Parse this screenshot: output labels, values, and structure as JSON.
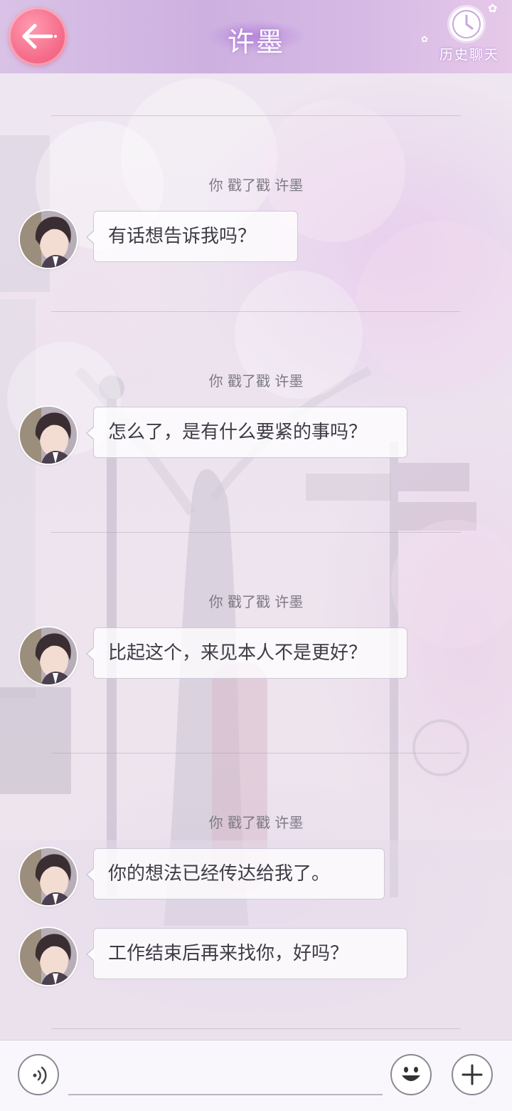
{
  "header": {
    "title": "许墨",
    "history_label": "历史聊天"
  },
  "chat": {
    "messages": [
      {
        "system": "你 戳了戳 许墨",
        "text": "有话想告诉我吗？"
      },
      {
        "system": "你 戳了戳 许墨",
        "text": "怎么了，是有什么要紧的事吗？"
      },
      {
        "system": "你 戳了戳 许墨",
        "text": "比起这个，来见本人不是更好？"
      },
      {
        "system": "你 戳了戳 许墨",
        "text": "你的想法已经传达给我了。"
      },
      {
        "system": "",
        "text": "工作结束后再来找你，好吗？"
      }
    ]
  },
  "input": {
    "value": "",
    "placeholder": ""
  },
  "colors": {
    "header_left": "#cdb0e0",
    "header_right": "#e6c9e9",
    "back_button": "#f56d8a",
    "bubble_text": "#3e3c45",
    "system_text": "#7d7a86"
  },
  "icons": {
    "back": "back-arrow-icon",
    "history": "clock-icon",
    "voice": "voice-icon",
    "emoji": "emoji-icon",
    "more": "plus-icon"
  }
}
